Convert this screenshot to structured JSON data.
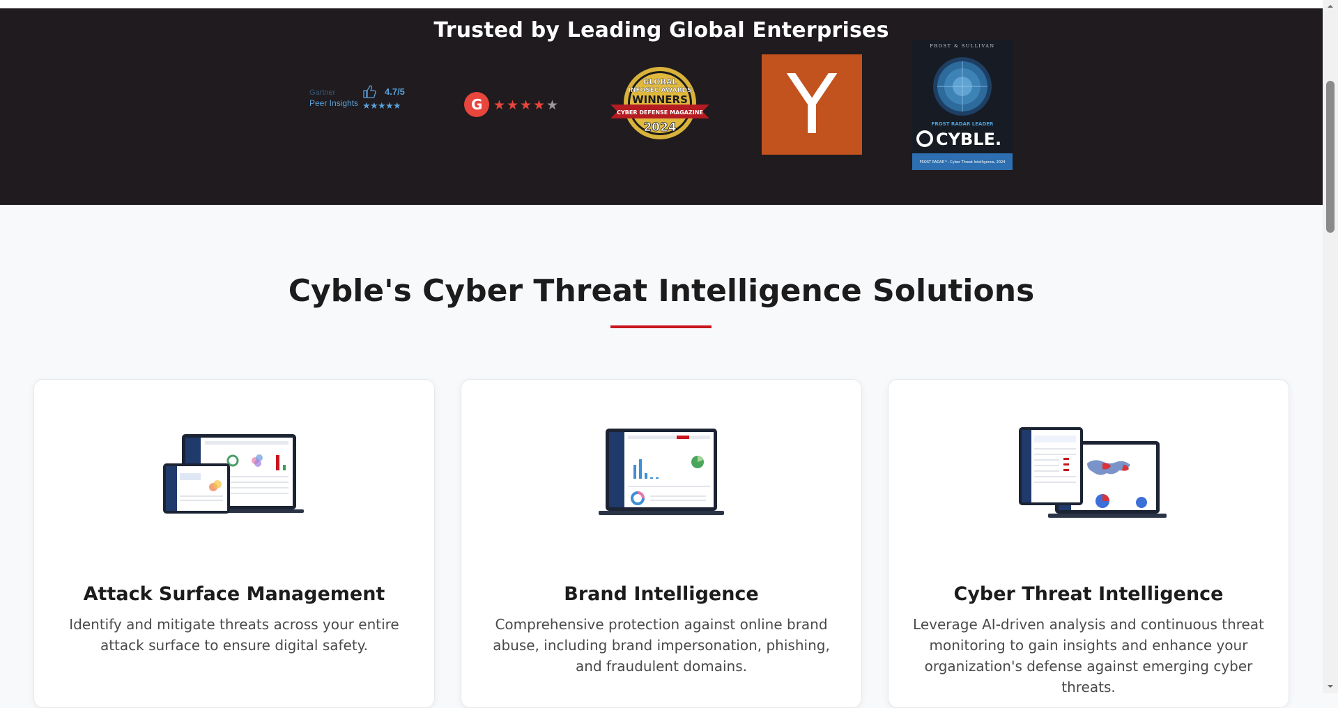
{
  "trust": {
    "title": "Trusted by Leading Global Enterprises",
    "logos": {
      "gartner": {
        "line1": "Gartner",
        "line2": "Peer Insights",
        "rating": "4.7/5"
      },
      "g2": {
        "letter": "G"
      },
      "infosec": {
        "line1": "GLOBAL",
        "line2": "INFOSEC AWARDS",
        "line3": "WINNERS",
        "ribbon": "CYBER DEFENSE MAGAZINE",
        "year": "2024"
      },
      "ycombinator": {
        "letter": "Y"
      },
      "frost": {
        "top": "FROST & SULLIVAN",
        "badge": "FROST RADAR LEADER",
        "brand": "CYBLE.",
        "footer": "FROST RADAR™: Cyber Threat Intelligence, 2024"
      }
    }
  },
  "solutions": {
    "title": "Cyble's Cyber Threat Intelligence Solutions",
    "cards": [
      {
        "title": "Attack Surface Management",
        "desc": "Identify and mitigate threats across your entire attack surface to ensure digital safety."
      },
      {
        "title": "Brand Intelligence",
        "desc": "Comprehensive protection against online brand abuse, including brand impersonation, phishing, and fraudulent domains."
      },
      {
        "title": "Cyber Threat Intelligence",
        "desc": "Leverage AI-driven analysis and continuous threat monitoring to gain insights and enhance your organization's defense against emerging cyber threats."
      }
    ]
  },
  "colors": {
    "dark_band": "#1f1b1e",
    "accent_red": "#c8161d",
    "yc_orange": "#c2521e"
  },
  "icons": [
    "thumbs-up-icon",
    "star-icon",
    "scroll-up-arrow-icon",
    "scroll-down-arrow-icon"
  ]
}
